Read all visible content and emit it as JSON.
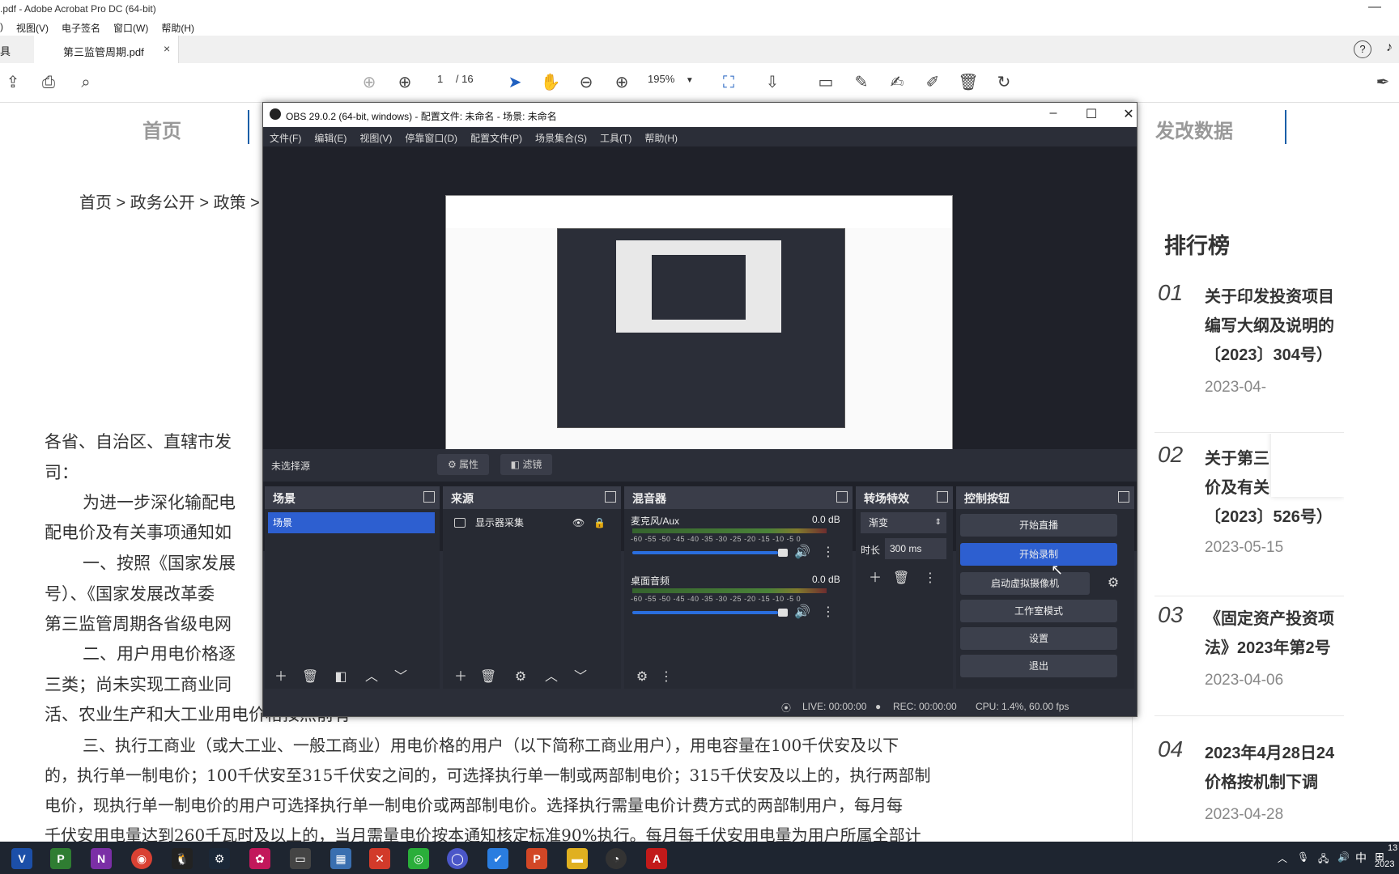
{
  "acrobat": {
    "title": ".pdf - Adobe Acrobat Pro DC (64-bit)",
    "menu": [
      "视图(V)",
      "电子签名",
      "窗口(W)",
      "帮助(H)"
    ],
    "tab_left_partial": "具",
    "doc_tab": "第三监管周期.pdf",
    "page_current": "1",
    "page_total": "/ 16",
    "zoom": "195%"
  },
  "web": {
    "nav_home": "首页",
    "nav_right": "发改数据",
    "breadcrumb": "首页 > 政务公开 > 政策 >",
    "body_lines": [
      "各省、自治区、直辖市发",
      "司：",
      "为进一步深化输配电",
      "配电价及有关事项通知如",
      "一、按照《国家发展",
      "号）、《国家发展改革委",
      "第三监管周期各省级电网",
      "二、用户用电价格逐",
      "三类；尚未实现工商业同",
      "活、农业生产和大工业用电价格按照前有"
    ],
    "body_full": [
      "三、执行工商业（或大工业、一般工商业）用电价格的用户（以下简称工商业用户），用电容量在100千伏安及以下",
      "的，执行单一制电价；100千伏安至315千伏安之间的，可选择执行单一制或两部制电价；315千伏安及以上的，执行两部制",
      "电价，现执行单一制电价的用户可选择执行单一制电价或两部制电价。选择执行需量电价计费方式的两部制用户，每月每",
      "千伏安用电量达到260千瓦时及以上的，当月需量电价按本通知核定标准90%执行。每月每千伏安用电量为用户所属全部计"
    ],
    "ranking_title": "排行榜",
    "rankings": [
      {
        "num": "01",
        "lines": [
          "关于印发投资项目",
          "编写大纲及说明的",
          "〔2023〕304号）"
        ],
        "date": "2023-04-"
      },
      {
        "num": "02",
        "lines": [
          "关于第三",
          "价及有关",
          "〔2023〕526号）"
        ],
        "date": "2023-05-15"
      },
      {
        "num": "03",
        "lines": [
          "《固定资产投资项",
          "法》2023年第2号"
        ],
        "date": "2023-04-06"
      },
      {
        "num": "04",
        "lines": [
          "2023年4月28日24",
          "价格按机制下调"
        ],
        "date": "2023-04-28"
      }
    ]
  },
  "obs": {
    "title": "OBS 29.0.2 (64-bit, windows) - 配置文件: 未命名 - 场景: 未命名",
    "menu": [
      "文件(F)",
      "编辑(E)",
      "视图(V)",
      "停靠窗口(D)",
      "配置文件(P)",
      "场景集合(S)",
      "工具(T)",
      "帮助(H)"
    ],
    "no_source": "未选择源",
    "properties": "属性",
    "filters": "滤镜",
    "scenes_title": "场景",
    "scene_item": "场景",
    "sources_title": "来源",
    "source_item": "显示器采集",
    "mixer_title": "混音器",
    "mic_label": "麦克风/Aux",
    "mic_db": "0.0 dB",
    "desktop_label": "桌面音频",
    "desktop_db": "0.0 dB",
    "meter_ticks": "-60  -55  -50  -45  -40  -35  -30  -25  -20  -15  -10   -5    0",
    "transitions_title": "转场特效",
    "transition_type": "渐变",
    "duration_label": "时长",
    "duration_value": "300 ms",
    "controls_title": "控制按钮",
    "btn_stream": "开始直播",
    "btn_record": "开始录制",
    "btn_virtualcam": "启动虚拟摄像机",
    "btn_studio": "工作室模式",
    "btn_settings": "设置",
    "btn_exit": "退出",
    "status_live": "LIVE: 00:00:00",
    "status_rec": "REC: 00:00:00",
    "status_cpu": "CPU: 1.4%, 60.00 fps"
  },
  "taskbar": {
    "ime": "中",
    "clock_top": "13",
    "clock_bottom": "2023"
  },
  "colors": {
    "obs_bg": "#2b2e38",
    "obs_accent": "#2d5fd0",
    "taskbar": "#1e2530"
  }
}
